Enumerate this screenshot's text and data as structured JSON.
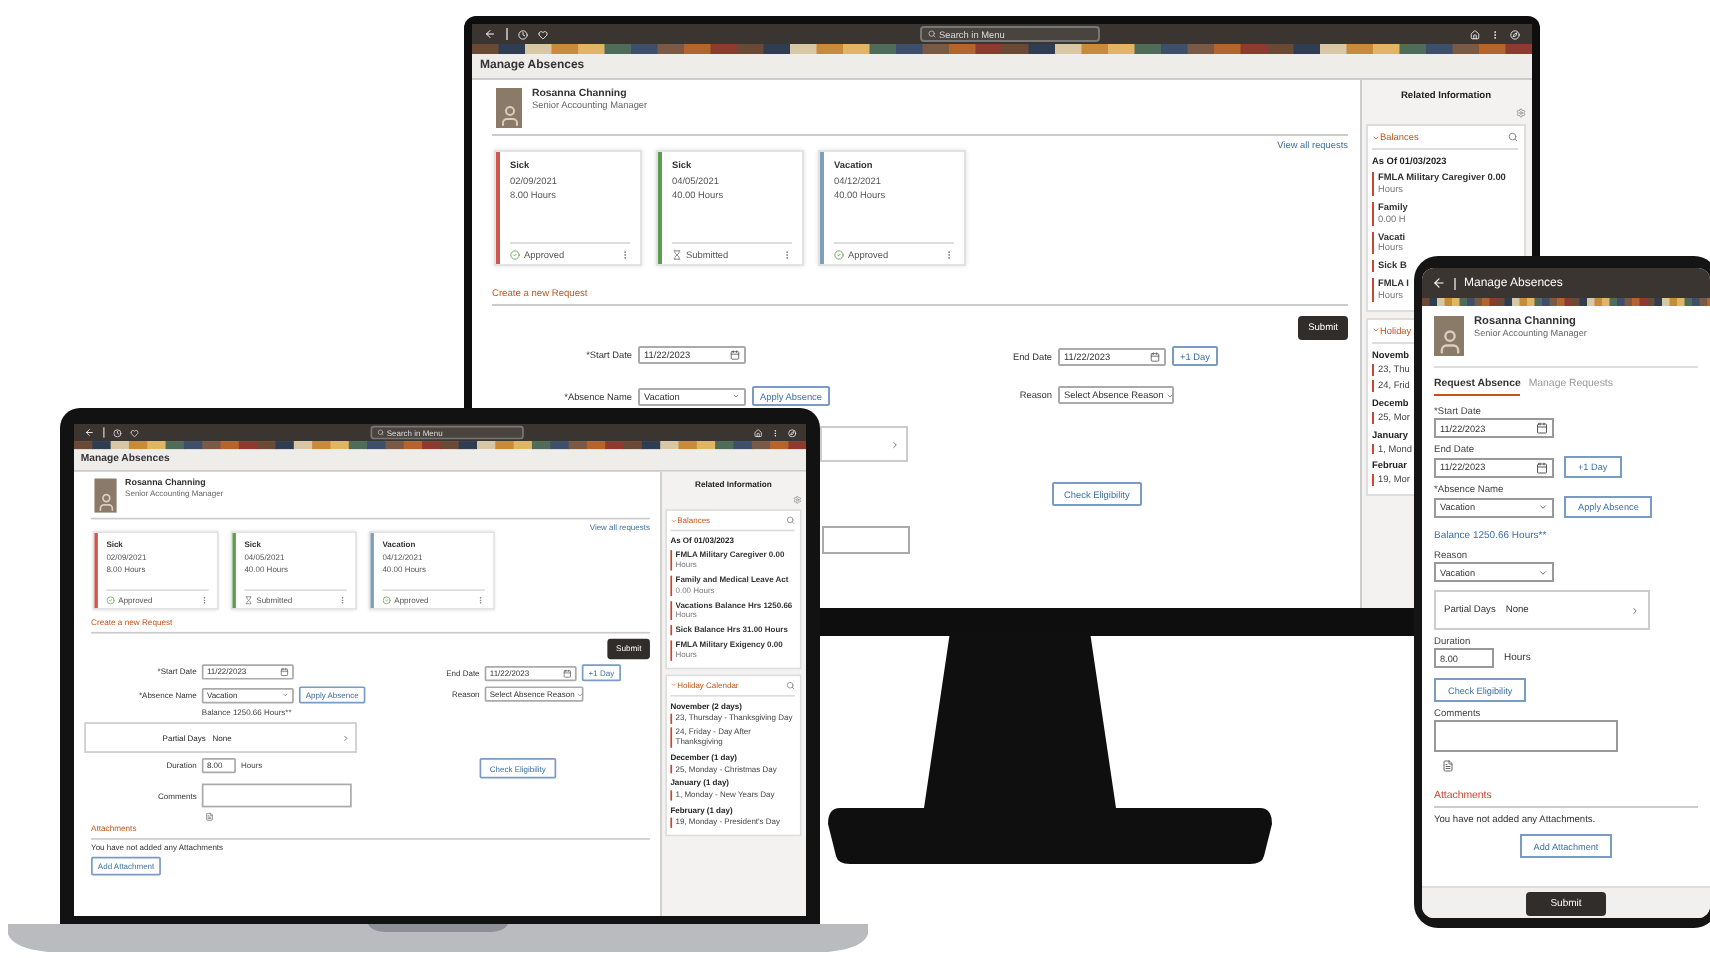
{
  "monitor": {
    "search_placeholder": "Search in Menu",
    "title": "Manage Absences",
    "profile": {
      "name": "Rosanna Channing",
      "role": "Senior Accounting Manager"
    },
    "view_all": "View all requests",
    "cards": [
      {
        "type": "Sick",
        "date": "02/09/2021",
        "hours": "8.00 Hours",
        "status": "Approved",
        "kind": "approved",
        "color": "#d0574f"
      },
      {
        "type": "Sick",
        "date": "04/05/2021",
        "hours": "40.00 Hours",
        "status": "Submitted",
        "kind": "submitted",
        "color": "#5a9e4c"
      },
      {
        "type": "Vacation",
        "date": "04/12/2021",
        "hours": "40.00 Hours",
        "status": "Approved",
        "kind": "approved",
        "color": "#7f9fb8"
      }
    ],
    "create_heading": "Create a new Request",
    "submit": "Submit",
    "rows": [
      {
        "left": {
          "kind": "date",
          "label": "*Start Date",
          "value": "11/22/2023"
        },
        "right": {
          "kind": "date",
          "label": "End Date",
          "value": "11/22/2023",
          "button": "+1 Day"
        }
      },
      {
        "left": {
          "kind": "select",
          "label": "*Absence Name",
          "value": "Vacation",
          "button": "Apply Absence"
        },
        "right": {
          "kind": "select",
          "label": "Reason",
          "value": "Select Absence Reason"
        }
      },
      {
        "left": {
          "kind": "partial"
        }
      },
      {
        "right": {
          "kind": "button",
          "label": "Check Eligibility"
        }
      },
      {
        "left": {
          "kind": "comments"
        }
      }
    ],
    "panel": {
      "title": "Related Information",
      "sections": [
        {
          "heading": "Balances",
          "searchable": true,
          "as_of": "As Of 01/03/2023",
          "items": [
            {
              "name": "FMLA Military Caregiver 0.00",
              "sub": "Hours"
            },
            {
              "name": "Family",
              "sub": "0.00 H"
            },
            {
              "name": "Vacati",
              "sub": "Hours"
            },
            {
              "name": "Sick B"
            },
            {
              "name": "FMLA I",
              "sub": "Hours"
            }
          ]
        },
        {
          "heading": "Holiday",
          "groups": [
            {
              "month": "Novemb",
              "days": [
                "23, Thu",
                "24, Frid"
              ]
            },
            {
              "month": "Decemb",
              "days": [
                "25, Mor"
              ]
            },
            {
              "month": "January",
              "days": [
                "1, Mond"
              ]
            },
            {
              "month": "Februar",
              "days": [
                "19, Mor"
              ]
            }
          ]
        }
      ]
    }
  },
  "laptop": {
    "search_placeholder": "Search in Menu",
    "title": "Manage Absences",
    "profile": {
      "name": "Rosanna Channing",
      "role": "Senior Accounting Manager"
    },
    "view_all": "View all requests",
    "cards": [
      {
        "type": "Sick",
        "date": "02/09/2021",
        "hours": "8.00 Hours",
        "status": "Approved",
        "kind": "approved",
        "color": "#d0574f"
      },
      {
        "type": "Sick",
        "date": "04/05/2021",
        "hours": "40.00 Hours",
        "status": "Submitted",
        "kind": "submitted",
        "color": "#5a9e4c"
      },
      {
        "type": "Vacation",
        "date": "04/12/2021",
        "hours": "40.00 Hours",
        "status": "Approved",
        "kind": "approved",
        "color": "#7f9fb8"
      }
    ],
    "create_heading": "Create a new Request",
    "submit": "Submit",
    "rows": [
      {
        "left": {
          "kind": "date",
          "label": "*Start Date",
          "value": "11/22/2023"
        },
        "right": {
          "kind": "date",
          "label": "End Date",
          "value": "11/22/2023",
          "button": "+1 Day"
        }
      },
      {
        "left": {
          "kind": "select",
          "label": "*Absence Name",
          "value": "Vacation",
          "button": "Apply Absence"
        },
        "right": {
          "kind": "select",
          "label": "Reason",
          "value": "Select Absence Reason"
        }
      },
      {
        "left": {
          "kind": "note",
          "text": "Balance 1250.66 Hours**"
        }
      },
      {
        "left": {
          "kind": "partial",
          "label": "Partial Days",
          "value": "None"
        }
      },
      {
        "left": {
          "kind": "duration",
          "label": "Duration",
          "value": "8.00",
          "unit": "Hours"
        },
        "right": {
          "kind": "button",
          "label": "Check Eligibility"
        }
      },
      {
        "left": {
          "kind": "comments",
          "label": "Comments"
        }
      },
      {
        "left": {
          "kind": "attach_icon"
        }
      }
    ],
    "attachments": {
      "heading": "Attachments",
      "empty": "You have not added any Attachments",
      "button": "Add Attachment"
    },
    "panel": {
      "title": "Related Information",
      "sections": [
        {
          "heading": "Balances",
          "searchable": true,
          "as_of": "As Of 01/03/2023",
          "items": [
            {
              "name": "FMLA Military Caregiver 0.00",
              "sub": "Hours"
            },
            {
              "name": "Family and Medical Leave Act",
              "sub": "0.00 Hours"
            },
            {
              "name": "Vacations Balance Hrs 1250.66",
              "sub": "Hours"
            },
            {
              "name": "Sick Balance Hrs 31.00 Hours"
            },
            {
              "name": "FMLA Military Exigency 0.00",
              "sub": "Hours"
            }
          ]
        },
        {
          "heading": "Holiday Calendar",
          "searchable": true,
          "groups": [
            {
              "month": "November (2 days)",
              "days": [
                "23, Thursday - Thanksgiving Day",
                "24, Friday - Day After Thanksgiving"
              ]
            },
            {
              "month": "December (1 day)",
              "days": [
                "25, Monday - Christmas Day"
              ]
            },
            {
              "month": "January (1 day)",
              "days": [
                "1, Monday - New Years Day"
              ]
            },
            {
              "month": "February (1 day)",
              "days": [
                "19, Monday - President's Day"
              ]
            }
          ]
        }
      ]
    }
  },
  "phone": {
    "title": "Manage Absences",
    "profile": {
      "name": "Rosanna Channing",
      "role": "Senior Accounting Manager"
    },
    "tabs": [
      {
        "label": "Request Absence",
        "selected": true
      },
      {
        "label": "Manage Requests",
        "selected": false
      }
    ],
    "fields": [
      {
        "kind": "date",
        "label": "*Start Date",
        "value": "11/22/2023"
      },
      {
        "kind": "date",
        "label": "End Date",
        "value": "11/22/2023",
        "button": "+1 Day"
      },
      {
        "kind": "select",
        "label": "*Absence Name",
        "value": "Vacation",
        "button": "Apply Absence"
      },
      {
        "kind": "note",
        "text": "Balance 1250.66 Hours**"
      },
      {
        "kind": "select",
        "label": "Reason",
        "value": "Vacation"
      },
      {
        "kind": "partial",
        "label": "Partial Days",
        "value": "None"
      },
      {
        "kind": "duration",
        "label": "Duration",
        "value": "8.00",
        "unit": "Hours"
      },
      {
        "kind": "button",
        "label": "Check Eligibility"
      },
      {
        "kind": "comments",
        "label": "Comments"
      },
      {
        "kind": "attach_icon"
      }
    ],
    "attachments": {
      "heading": "Attachments",
      "empty": "You have not added any Attachments.",
      "button": "Add Attachment"
    },
    "submit": "Submit"
  }
}
